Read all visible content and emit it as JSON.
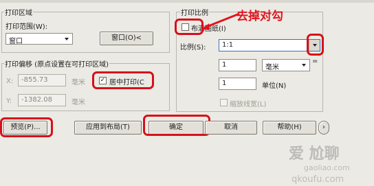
{
  "print_area": {
    "group_title": "打印区域",
    "range_label": "打印范围(W):",
    "range_value": "窗口",
    "window_button": "窗口(O)<"
  },
  "print_offset": {
    "group_title": "打印偏移 (原点设置在可打印区域)",
    "x_label": "X:",
    "x_value": "-855.73",
    "x_unit": "毫米",
    "y_label": "Y:",
    "y_value": "-1382.08",
    "y_unit": "毫米",
    "center_label": "居中打印(C",
    "center_checked": "✓"
  },
  "print_scale": {
    "group_title": "打印比例",
    "fit_label": "布满图纸(I)",
    "scale_label": "比例(S):",
    "scale_value": "1:1",
    "value1": "1",
    "unit_value": "毫米",
    "equals": "=",
    "value2": "1",
    "unit2_label": "单位(N)",
    "lineweight_label": "缩放线宽(L)"
  },
  "buttons": {
    "preview": "预览(P)...",
    "apply_layout": "应用到布局(T)",
    "ok": "确定",
    "cancel": "取消",
    "help": "帮助(H)",
    "expand": "›"
  },
  "annotation": {
    "text": "去掉对勾",
    "color": "#e0141e"
  },
  "watermark": {
    "logo_text": "爱 尬聊",
    "site_cn": "gaoliao.com",
    "site_pinyin": "qkoufu.com"
  }
}
